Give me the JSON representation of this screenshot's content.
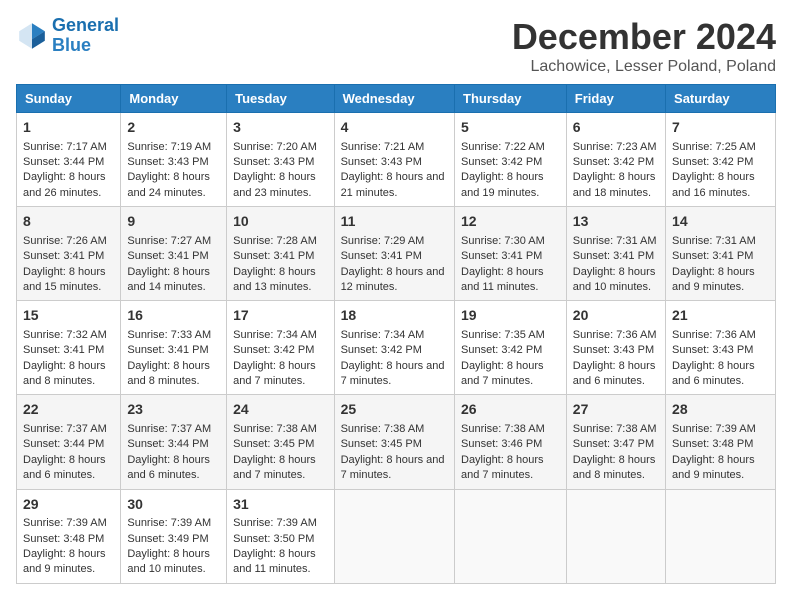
{
  "logo": {
    "line1": "General",
    "line2": "Blue"
  },
  "title": "December 2024",
  "subtitle": "Lachowice, Lesser Poland, Poland",
  "days_of_week": [
    "Sunday",
    "Monday",
    "Tuesday",
    "Wednesday",
    "Thursday",
    "Friday",
    "Saturday"
  ],
  "weeks": [
    [
      {
        "day": "1",
        "sunrise": "Sunrise: 7:17 AM",
        "sunset": "Sunset: 3:44 PM",
        "daylight": "Daylight: 8 hours and 26 minutes."
      },
      {
        "day": "2",
        "sunrise": "Sunrise: 7:19 AM",
        "sunset": "Sunset: 3:43 PM",
        "daylight": "Daylight: 8 hours and 24 minutes."
      },
      {
        "day": "3",
        "sunrise": "Sunrise: 7:20 AM",
        "sunset": "Sunset: 3:43 PM",
        "daylight": "Daylight: 8 hours and 23 minutes."
      },
      {
        "day": "4",
        "sunrise": "Sunrise: 7:21 AM",
        "sunset": "Sunset: 3:43 PM",
        "daylight": "Daylight: 8 hours and 21 minutes."
      },
      {
        "day": "5",
        "sunrise": "Sunrise: 7:22 AM",
        "sunset": "Sunset: 3:42 PM",
        "daylight": "Daylight: 8 hours and 19 minutes."
      },
      {
        "day": "6",
        "sunrise": "Sunrise: 7:23 AM",
        "sunset": "Sunset: 3:42 PM",
        "daylight": "Daylight: 8 hours and 18 minutes."
      },
      {
        "day": "7",
        "sunrise": "Sunrise: 7:25 AM",
        "sunset": "Sunset: 3:42 PM",
        "daylight": "Daylight: 8 hours and 16 minutes."
      }
    ],
    [
      {
        "day": "8",
        "sunrise": "Sunrise: 7:26 AM",
        "sunset": "Sunset: 3:41 PM",
        "daylight": "Daylight: 8 hours and 15 minutes."
      },
      {
        "day": "9",
        "sunrise": "Sunrise: 7:27 AM",
        "sunset": "Sunset: 3:41 PM",
        "daylight": "Daylight: 8 hours and 14 minutes."
      },
      {
        "day": "10",
        "sunrise": "Sunrise: 7:28 AM",
        "sunset": "Sunset: 3:41 PM",
        "daylight": "Daylight: 8 hours and 13 minutes."
      },
      {
        "day": "11",
        "sunrise": "Sunrise: 7:29 AM",
        "sunset": "Sunset: 3:41 PM",
        "daylight": "Daylight: 8 hours and 12 minutes."
      },
      {
        "day": "12",
        "sunrise": "Sunrise: 7:30 AM",
        "sunset": "Sunset: 3:41 PM",
        "daylight": "Daylight: 8 hours and 11 minutes."
      },
      {
        "day": "13",
        "sunrise": "Sunrise: 7:31 AM",
        "sunset": "Sunset: 3:41 PM",
        "daylight": "Daylight: 8 hours and 10 minutes."
      },
      {
        "day": "14",
        "sunrise": "Sunrise: 7:31 AM",
        "sunset": "Sunset: 3:41 PM",
        "daylight": "Daylight: 8 hours and 9 minutes."
      }
    ],
    [
      {
        "day": "15",
        "sunrise": "Sunrise: 7:32 AM",
        "sunset": "Sunset: 3:41 PM",
        "daylight": "Daylight: 8 hours and 8 minutes."
      },
      {
        "day": "16",
        "sunrise": "Sunrise: 7:33 AM",
        "sunset": "Sunset: 3:41 PM",
        "daylight": "Daylight: 8 hours and 8 minutes."
      },
      {
        "day": "17",
        "sunrise": "Sunrise: 7:34 AM",
        "sunset": "Sunset: 3:42 PM",
        "daylight": "Daylight: 8 hours and 7 minutes."
      },
      {
        "day": "18",
        "sunrise": "Sunrise: 7:34 AM",
        "sunset": "Sunset: 3:42 PM",
        "daylight": "Daylight: 8 hours and 7 minutes."
      },
      {
        "day": "19",
        "sunrise": "Sunrise: 7:35 AM",
        "sunset": "Sunset: 3:42 PM",
        "daylight": "Daylight: 8 hours and 7 minutes."
      },
      {
        "day": "20",
        "sunrise": "Sunrise: 7:36 AM",
        "sunset": "Sunset: 3:43 PM",
        "daylight": "Daylight: 8 hours and 6 minutes."
      },
      {
        "day": "21",
        "sunrise": "Sunrise: 7:36 AM",
        "sunset": "Sunset: 3:43 PM",
        "daylight": "Daylight: 8 hours and 6 minutes."
      }
    ],
    [
      {
        "day": "22",
        "sunrise": "Sunrise: 7:37 AM",
        "sunset": "Sunset: 3:44 PM",
        "daylight": "Daylight: 8 hours and 6 minutes."
      },
      {
        "day": "23",
        "sunrise": "Sunrise: 7:37 AM",
        "sunset": "Sunset: 3:44 PM",
        "daylight": "Daylight: 8 hours and 6 minutes."
      },
      {
        "day": "24",
        "sunrise": "Sunrise: 7:38 AM",
        "sunset": "Sunset: 3:45 PM",
        "daylight": "Daylight: 8 hours and 7 minutes."
      },
      {
        "day": "25",
        "sunrise": "Sunrise: 7:38 AM",
        "sunset": "Sunset: 3:45 PM",
        "daylight": "Daylight: 8 hours and 7 minutes."
      },
      {
        "day": "26",
        "sunrise": "Sunrise: 7:38 AM",
        "sunset": "Sunset: 3:46 PM",
        "daylight": "Daylight: 8 hours and 7 minutes."
      },
      {
        "day": "27",
        "sunrise": "Sunrise: 7:38 AM",
        "sunset": "Sunset: 3:47 PM",
        "daylight": "Daylight: 8 hours and 8 minutes."
      },
      {
        "day": "28",
        "sunrise": "Sunrise: 7:39 AM",
        "sunset": "Sunset: 3:48 PM",
        "daylight": "Daylight: 8 hours and 9 minutes."
      }
    ],
    [
      {
        "day": "29",
        "sunrise": "Sunrise: 7:39 AM",
        "sunset": "Sunset: 3:48 PM",
        "daylight": "Daylight: 8 hours and 9 minutes."
      },
      {
        "day": "30",
        "sunrise": "Sunrise: 7:39 AM",
        "sunset": "Sunset: 3:49 PM",
        "daylight": "Daylight: 8 hours and 10 minutes."
      },
      {
        "day": "31",
        "sunrise": "Sunrise: 7:39 AM",
        "sunset": "Sunset: 3:50 PM",
        "daylight": "Daylight: 8 hours and 11 minutes."
      },
      null,
      null,
      null,
      null
    ]
  ]
}
